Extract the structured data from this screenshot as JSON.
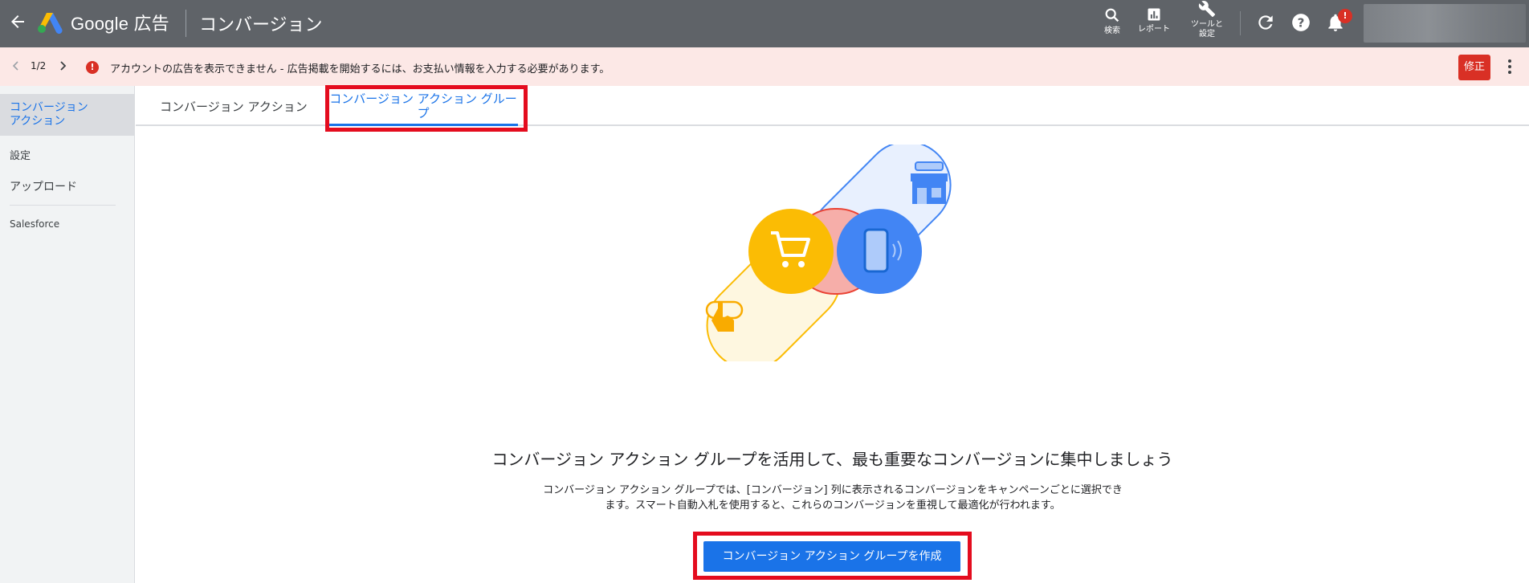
{
  "header": {
    "brand": "Google 広告",
    "page_title": "コンバージョン",
    "tools": {
      "search": "検索",
      "report": "レポート",
      "tools_line1": "ツールと",
      "tools_line2": "設定"
    },
    "notification_badge": "!"
  },
  "alert": {
    "pager": "1/2",
    "icon": "!",
    "message": "アカウントの広告を表示できません - 広告掲載を開始するには、お支払い情報を入力する必要があります。",
    "fix_label": "修正"
  },
  "sidebar": {
    "items": [
      {
        "label_line1": "コンバージョン",
        "label_line2": "アクション",
        "active": true
      },
      {
        "label": "設定"
      },
      {
        "label": "アップロード"
      },
      {
        "label": "Salesforce"
      }
    ]
  },
  "tabs": [
    {
      "label": "コンバージョン アクション",
      "active": false
    },
    {
      "label_line1": "コンバージョン アクション グルー",
      "label_line2": "プ",
      "active": true
    }
  ],
  "empty_state": {
    "headline": "コンバージョン アクション グループを活用して、最も重要なコンバージョンに集中しましょう",
    "desc_line1": "コンバージョン アクション グループでは、[コンバージョン] 列に表示されるコンバージョンをキャンペーンごとに選択でき",
    "desc_line2": "ます。スマート自動入札を使用すると、これらのコンバージョンを重視して最適化が行われます。",
    "create_button": "コンバージョン アクション グループを作成"
  },
  "colors": {
    "topbar": "#5f6368",
    "alert_bg": "#fce8e6",
    "accent_blue": "#1a73e8",
    "error_red": "#d93025",
    "highlight_red": "#e40c1e",
    "illus_yellow": "#fbbc04",
    "illus_blue": "#4285f4"
  },
  "icons": [
    "back-arrow-icon",
    "google-ads-logo",
    "search-icon",
    "report-icon",
    "wrench-icon",
    "refresh-icon",
    "help-icon",
    "bell-icon",
    "chevron-left-icon",
    "chevron-right-icon",
    "error-icon",
    "more-vert-icon",
    "shopping-cart-icon",
    "smartphone-icon",
    "storefront-icon",
    "tap-hand-icon"
  ]
}
